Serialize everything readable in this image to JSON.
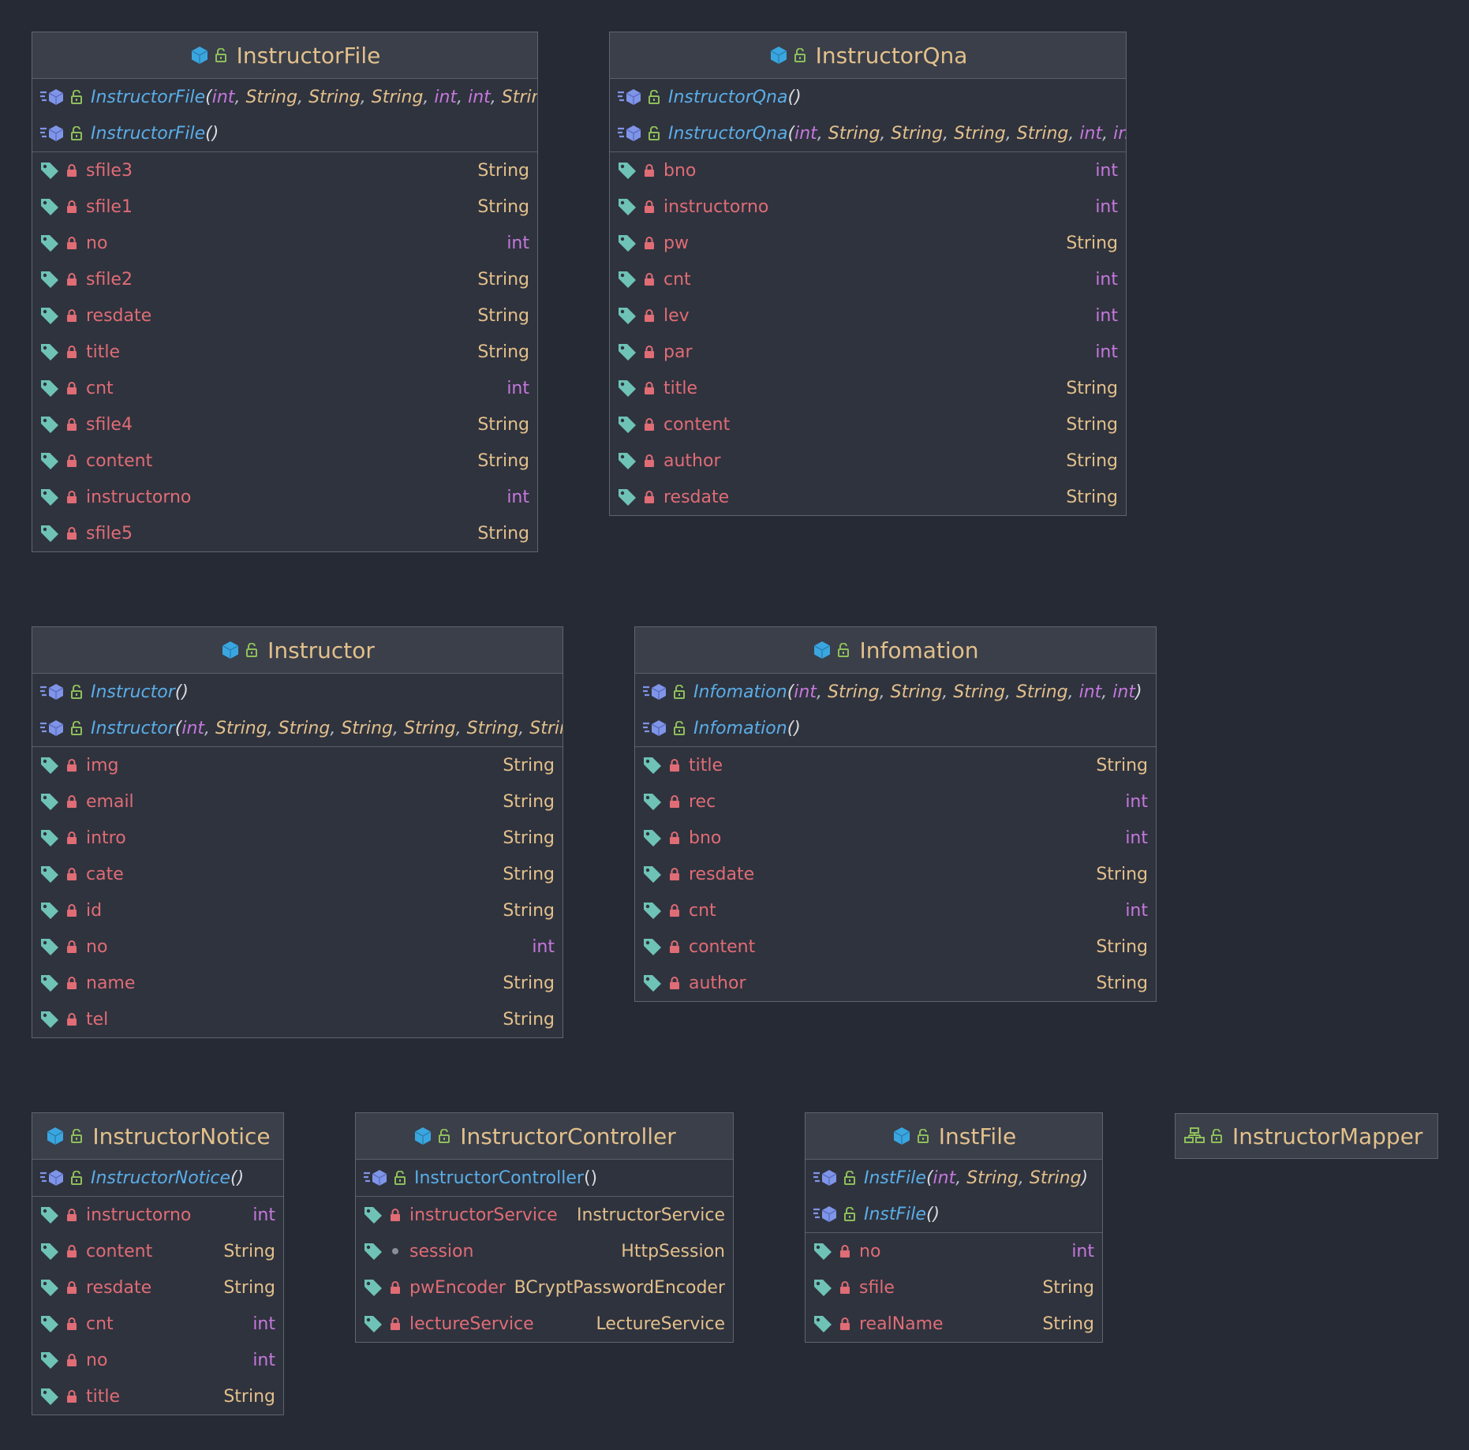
{
  "classes": [
    {
      "id": "instructor-file",
      "name": "InstructorFile",
      "constructors": [
        {
          "name": "InstructorFile",
          "params": [
            "int",
            "String",
            "String",
            "String",
            "int",
            "int",
            "String"
          ]
        },
        {
          "name": "InstructorFile",
          "params": []
        }
      ],
      "fields": [
        {
          "name": "sfile3",
          "type": "String"
        },
        {
          "name": "sfile1",
          "type": "String"
        },
        {
          "name": "no",
          "type": "int"
        },
        {
          "name": "sfile2",
          "type": "String"
        },
        {
          "name": "resdate",
          "type": "String"
        },
        {
          "name": "title",
          "type": "String"
        },
        {
          "name": "cnt",
          "type": "int"
        },
        {
          "name": "sfile4",
          "type": "String"
        },
        {
          "name": "content",
          "type": "String"
        },
        {
          "name": "instructorno",
          "type": "int"
        },
        {
          "name": "sfile5",
          "type": "String"
        }
      ]
    },
    {
      "id": "instructor-qna",
      "name": "InstructorQna",
      "constructors": [
        {
          "name": "InstructorQna",
          "params": []
        },
        {
          "name": "InstructorQna",
          "params": [
            "int",
            "String",
            "String",
            "String",
            "String",
            "int",
            "int"
          ]
        }
      ],
      "fields": [
        {
          "name": "bno",
          "type": "int"
        },
        {
          "name": "instructorno",
          "type": "int"
        },
        {
          "name": "pw",
          "type": "String"
        },
        {
          "name": "cnt",
          "type": "int"
        },
        {
          "name": "lev",
          "type": "int"
        },
        {
          "name": "par",
          "type": "int"
        },
        {
          "name": "title",
          "type": "String"
        },
        {
          "name": "content",
          "type": "String"
        },
        {
          "name": "author",
          "type": "String"
        },
        {
          "name": "resdate",
          "type": "String"
        }
      ]
    },
    {
      "id": "instructor",
      "name": "Instructor",
      "constructors": [
        {
          "name": "Instructor",
          "params": []
        },
        {
          "name": "Instructor",
          "params": [
            "int",
            "String",
            "String",
            "String",
            "String",
            "String",
            "String"
          ]
        }
      ],
      "fields": [
        {
          "name": "img",
          "type": "String"
        },
        {
          "name": "email",
          "type": "String"
        },
        {
          "name": "intro",
          "type": "String"
        },
        {
          "name": "cate",
          "type": "String"
        },
        {
          "name": "id",
          "type": "String"
        },
        {
          "name": "no",
          "type": "int"
        },
        {
          "name": "name",
          "type": "String"
        },
        {
          "name": "tel",
          "type": "String"
        }
      ]
    },
    {
      "id": "infomation",
      "name": "Infomation",
      "constructors": [
        {
          "name": "Infomation",
          "params": [
            "int",
            "String",
            "String",
            "String",
            "String",
            "int",
            "int"
          ]
        },
        {
          "name": "Infomation",
          "params": []
        }
      ],
      "fields": [
        {
          "name": "title",
          "type": "String"
        },
        {
          "name": "rec",
          "type": "int"
        },
        {
          "name": "bno",
          "type": "int"
        },
        {
          "name": "resdate",
          "type": "String"
        },
        {
          "name": "cnt",
          "type": "int"
        },
        {
          "name": "content",
          "type": "String"
        },
        {
          "name": "author",
          "type": "String"
        }
      ]
    },
    {
      "id": "instructor-notice",
      "name": "InstructorNotice",
      "constructors": [
        {
          "name": "InstructorNotice",
          "params": []
        }
      ],
      "fields": [
        {
          "name": "instructorno",
          "type": "int"
        },
        {
          "name": "content",
          "type": "String"
        },
        {
          "name": "resdate",
          "type": "String"
        },
        {
          "name": "cnt",
          "type": "int"
        },
        {
          "name": "no",
          "type": "int"
        },
        {
          "name": "title",
          "type": "String"
        }
      ]
    },
    {
      "id": "instructor-controller",
      "name": "InstructorController",
      "constructors": [
        {
          "name": "InstructorController",
          "params": [],
          "plain": true
        }
      ],
      "fields": [
        {
          "name": "instructorService",
          "type": "InstructorService",
          "access": "private"
        },
        {
          "name": "session",
          "type": "HttpSession",
          "access": "package"
        },
        {
          "name": "pwEncoder",
          "type": "BCryptPasswordEncoder",
          "access": "private"
        },
        {
          "name": "lectureService",
          "type": "LectureService",
          "access": "private"
        }
      ]
    },
    {
      "id": "inst-file",
      "name": "InstFile",
      "constructors": [
        {
          "name": "InstFile",
          "params": [
            "int",
            "String",
            "String"
          ]
        },
        {
          "name": "InstFile",
          "params": []
        }
      ],
      "fields": [
        {
          "name": "no",
          "type": "int"
        },
        {
          "name": "sfile",
          "type": "String"
        },
        {
          "name": "realName",
          "type": "String"
        }
      ]
    }
  ],
  "interface": {
    "name": "InstructorMapper"
  },
  "colors": {
    "background": "#262a34",
    "class_body": "#2f333e",
    "class_header": "#3a3f4a",
    "class_name": "#e3c08b",
    "field_name": "#e06c75",
    "type_int": "#c678dd",
    "type_string": "#e3c08b",
    "constructor": "#5aaee8",
    "class_icon": "#3aa6e0",
    "public_lock": "#8fbf5a",
    "private_lock": "#e06c75",
    "field_tag": "#6ec3b6"
  }
}
